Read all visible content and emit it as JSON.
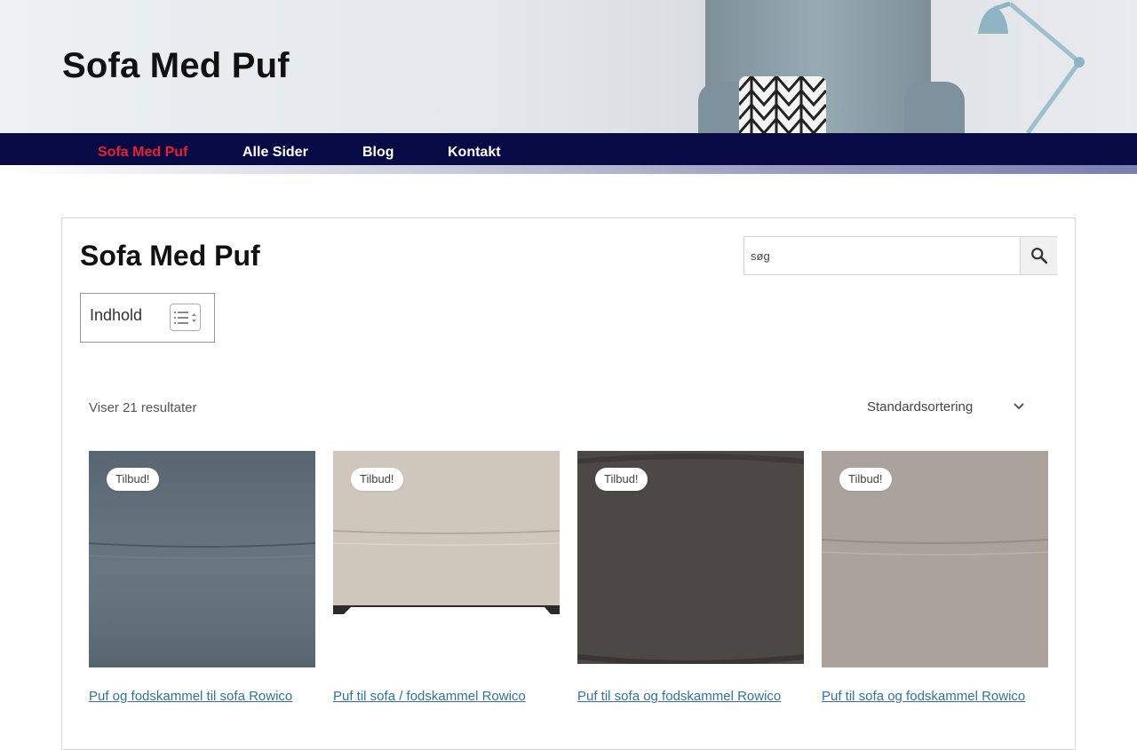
{
  "site": {
    "title": "Sofa Med Puf"
  },
  "nav": {
    "items": [
      {
        "label": "Sofa Med Puf",
        "active": true
      },
      {
        "label": "Alle Sider",
        "active": false
      },
      {
        "label": "Blog",
        "active": false
      },
      {
        "label": "Kontakt",
        "active": false
      }
    ]
  },
  "main": {
    "title": "Sofa Med Puf",
    "search": {
      "placeholder": "søg",
      "button_icon": "search-icon"
    },
    "toc": {
      "title": "Indhold",
      "toggle_icon": "list-toggle-icon"
    },
    "result_count": "Viser 21 resultater",
    "sort": {
      "selected": "Standardsortering",
      "icon": "chevron-down-icon"
    },
    "products": [
      {
        "badge": "Tilbud!",
        "name": "Puf og fodskammel til sofa Rowico",
        "color": "#5e6e79"
      },
      {
        "badge": "Tilbud!",
        "name": "Puf til sofa / fodskammel Rowico",
        "color": "#cfc6bc"
      },
      {
        "badge": "Tilbud!",
        "name": "Puf til sofa og fodskammel Rowico",
        "color": "#4c4844"
      },
      {
        "badge": "Tilbud!",
        "name": "Puf til sofa og fodskammel Rowico",
        "color": "#a9a39c"
      }
    ]
  },
  "colors": {
    "nav_bg": "#070a44",
    "nav_active": "#e8212e",
    "link": "#2f72a8"
  }
}
